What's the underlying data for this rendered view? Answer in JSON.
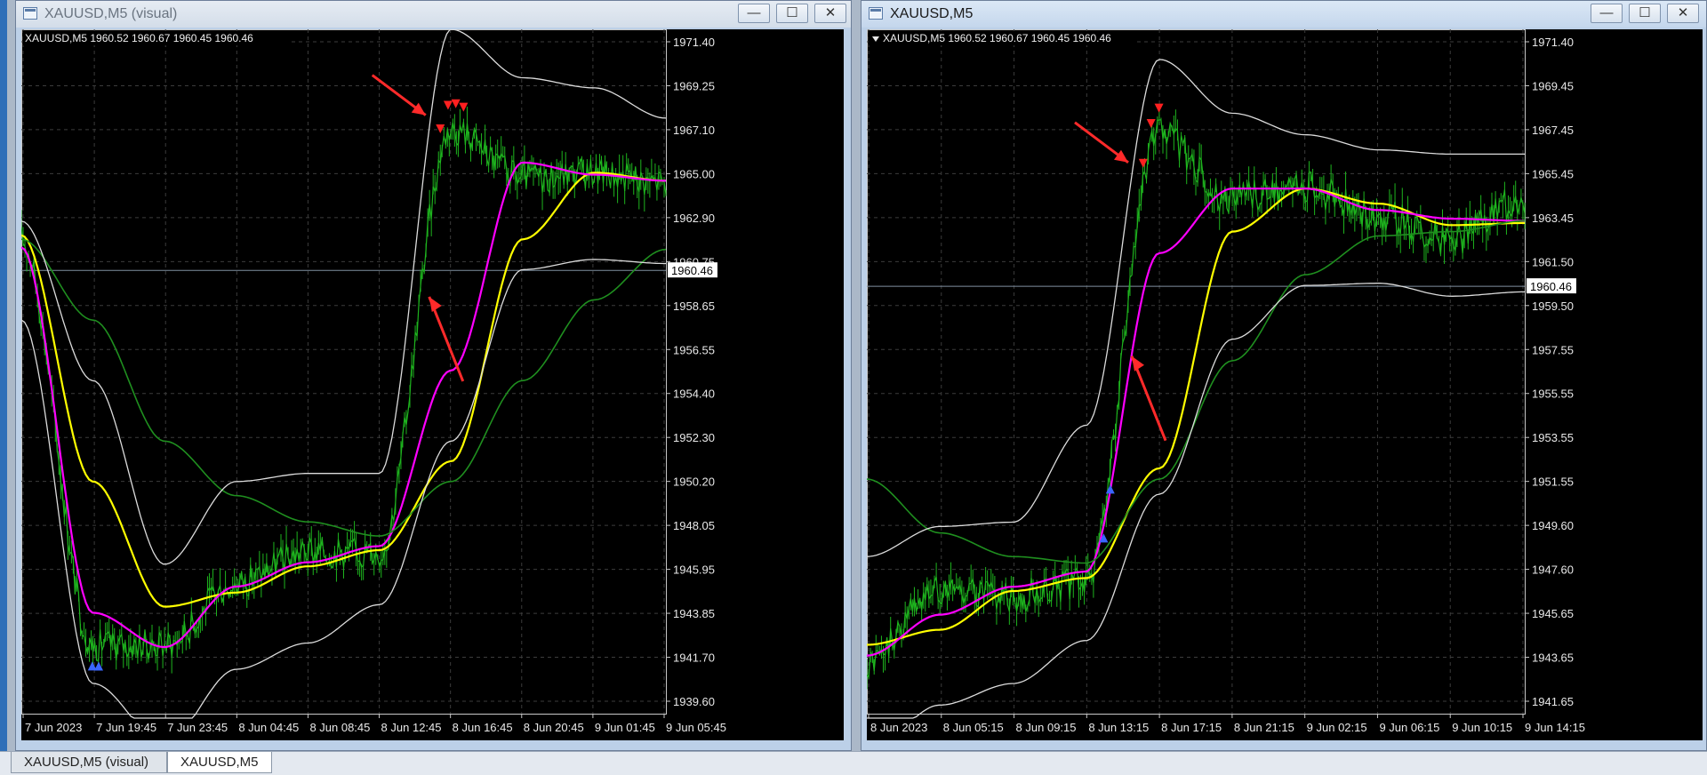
{
  "windows": [
    {
      "title": "XAUUSD,M5 (visual)",
      "info": "XAUUSD,M5  1960.52 1960.67 1960.45 1960.46",
      "price_ticks": [
        "1971.40",
        "1969.25",
        "1967.10",
        "1965.00",
        "1962.90",
        "1960.75",
        "1958.65",
        "1956.55",
        "1954.40",
        "1952.30",
        "1950.20",
        "1948.05",
        "1945.95",
        "1943.85",
        "1941.70",
        "1939.60"
      ],
      "current_price": "1960.46",
      "time_ticks": [
        "7 Jun 2023",
        "7 Jun 19:45",
        "7 Jun 23:45",
        "8 Jun 04:45",
        "8 Jun 08:45",
        "8 Jun 12:45",
        "8 Jun 16:45",
        "8 Jun 20:45",
        "9 Jun 01:45",
        "9 Jun 05:45"
      ]
    },
    {
      "title": "XAUUSD,M5",
      "info": "XAUUSD,M5  1960.52 1960.67 1960.45 1960.46",
      "price_ticks": [
        "1971.40",
        "1969.45",
        "1967.45",
        "1965.45",
        "1963.45",
        "1961.50",
        "1959.50",
        "1957.55",
        "1955.55",
        "1953.55",
        "1951.55",
        "1949.60",
        "1947.60",
        "1945.65",
        "1943.65",
        "1941.65"
      ],
      "current_price": "1960.46",
      "time_ticks": [
        "8 Jun 2023",
        "8 Jun 05:15",
        "8 Jun 09:15",
        "8 Jun 13:15",
        "8 Jun 17:15",
        "8 Jun 21:15",
        "9 Jun 02:15",
        "9 Jun 06:15",
        "9 Jun 10:15",
        "9 Jun 14:15"
      ]
    }
  ],
  "tabs": [
    {
      "label": "XAUUSD,M5 (visual)",
      "active": false
    },
    {
      "label": "XAUUSD,M5",
      "active": true
    }
  ],
  "buttons": {
    "minimize": "—",
    "maximize": "☐",
    "close": "✕"
  },
  "colors": {
    "price": "#1eb41e",
    "ma_yellow": "#ffff00",
    "ma_magenta": "#ff00ff",
    "ma_green": "#1f8f1f",
    "band": "#dcdcdc",
    "grid": "#3c3c3c",
    "arrow": "#ff2a2a"
  },
  "chart_data": [
    {
      "type": "line",
      "title": "XAUUSD,M5",
      "symbol": "XAUUSD",
      "timeframe": "M5",
      "ohlc": {
        "open": 1960.52,
        "high": 1960.67,
        "low": 1960.45,
        "close": 1960.46
      },
      "ylim": [
        1938.5,
        1972.4
      ],
      "x": [
        "7 Jun 2023",
        "7 Jun 19:45",
        "7 Jun 23:45",
        "8 Jun 04:45",
        "8 Jun 08:45",
        "8 Jun 12:45",
        "8 Jun 16:45",
        "8 Jun 20:45",
        "9 Jun 01:45",
        "9 Jun 05:45"
      ],
      "series": [
        {
          "values": [
            1962.0,
            1941.9,
            1941.9,
            1945.0,
            1946.5,
            1946.5,
            1967.5,
            1965.0,
            1965.3,
            1964.8
          ]
        },
        {
          "values": [
            1962.2,
            1950.0,
            1943.8,
            1944.5,
            1945.8,
            1946.6,
            1951.0,
            1962.0,
            1965.3,
            1964.9
          ]
        },
        {
          "values": [
            1961.6,
            1943.5,
            1941.8,
            1944.8,
            1946.0,
            1946.8,
            1955.5,
            1965.8,
            1965.2,
            1964.9
          ]
        },
        {
          "values": [
            1962.0,
            1958.0,
            1952.0,
            1949.3,
            1948.0,
            1947.3,
            1950.0,
            1955.0,
            1959.0,
            1961.5
          ]
        },
        {
          "values": [
            1962.9,
            1955.0,
            1945.9,
            1950.0,
            1950.4,
            1950.4,
            1972.4,
            1970.0,
            1969.5,
            1968.0
          ]
        },
        {
          "values": [
            1958.0,
            1940.0,
            1937.0,
            1940.7,
            1942.0,
            1943.9,
            1952.0,
            1960.5,
            1961.0,
            1960.8
          ]
        }
      ],
      "current_price": 1960.46,
      "sell_arrows": 4,
      "buy_arrows": 2,
      "grid": true
    },
    {
      "type": "line",
      "title": "XAUUSD,M5",
      "symbol": "XAUUSD",
      "timeframe": "M5",
      "ohlc": {
        "open": 1960.52,
        "high": 1960.67,
        "low": 1960.45,
        "close": 1960.46
      },
      "ylim": [
        1940.6,
        1972.4
      ],
      "x": [
        "8 Jun 2023",
        "8 Jun 05:15",
        "8 Jun 09:15",
        "8 Jun 13:15",
        "8 Jun 17:15",
        "8 Jun 21:15",
        "9 Jun 02:15",
        "9 Jun 06:15",
        "9 Jun 10:15",
        "9 Jun 14:15"
      ],
      "series": [
        {
          "values": [
            1943.0,
            1946.5,
            1946.0,
            1946.8,
            1967.5,
            1964.5,
            1965.0,
            1963.8,
            1962.6,
            1964.5
          ]
        },
        {
          "values": [
            1943.8,
            1944.5,
            1946.3,
            1946.9,
            1952.0,
            1963.0,
            1965.0,
            1964.3,
            1963.3,
            1963.4
          ]
        },
        {
          "values": [
            1943.3,
            1945.2,
            1946.5,
            1947.2,
            1962.0,
            1965.0,
            1965.0,
            1964.0,
            1963.6,
            1963.5
          ]
        },
        {
          "values": [
            1951.5,
            1949.0,
            1947.9,
            1947.6,
            1951.5,
            1957.0,
            1961.0,
            1962.8,
            1963.0,
            1963.5
          ]
        },
        {
          "values": [
            1947.9,
            1949.3,
            1949.5,
            1954.0,
            1971.0,
            1968.5,
            1967.5,
            1966.8,
            1966.6,
            1966.6
          ]
        },
        {
          "values": [
            1938.8,
            1941.0,
            1942.0,
            1944.0,
            1950.8,
            1958.0,
            1960.5,
            1960.6,
            1960.0,
            1960.2
          ]
        }
      ],
      "current_price": 1960.46,
      "sell_arrows": 3,
      "buy_arrows": 2,
      "grid": true
    }
  ]
}
